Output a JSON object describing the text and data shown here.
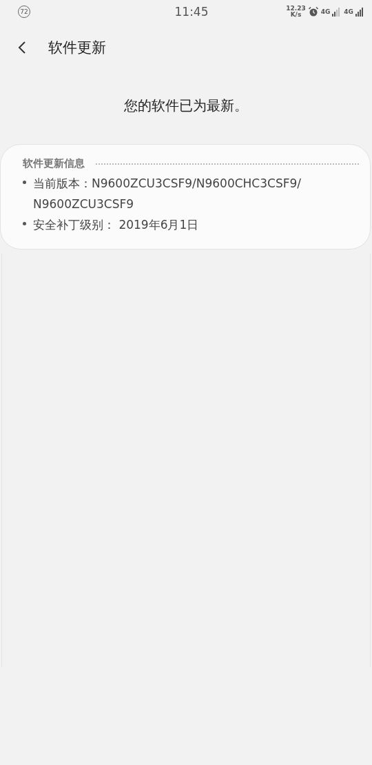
{
  "status_bar": {
    "badge": "72",
    "time": "11:45",
    "speed_value": "12.23",
    "speed_unit": "K/s",
    "network_1": "4G",
    "network_2": "4G"
  },
  "header": {
    "title": "软件更新"
  },
  "message": "您的软件已为最新。",
  "info_card": {
    "title": "软件更新信息",
    "items": [
      {
        "label": "当前版本：",
        "value": "N9600ZCU3CSF9/N9600CHC3CSF9/ N9600ZCU3CSF9"
      },
      {
        "label": "安全补丁级别：",
        "value": " 2019年6月1日"
      }
    ]
  }
}
